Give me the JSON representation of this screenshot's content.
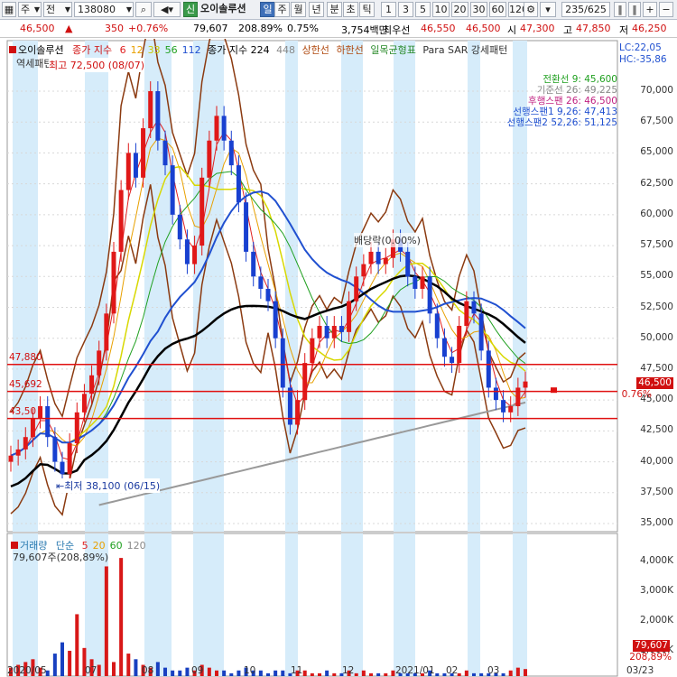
{
  "toolbar": {
    "market": "주",
    "period_mode": "전",
    "code": "138080",
    "stock_name": "오이솔루션",
    "stock_badge": "신",
    "periods": [
      "일",
      "주",
      "월",
      "년",
      "분",
      "초",
      "틱"
    ],
    "active_period": "일",
    "minutes": [
      "1",
      "3",
      "5",
      "10",
      "20",
      "30",
      "60",
      "120"
    ],
    "page": "235/625"
  },
  "quote": {
    "price": "46,500",
    "change": "350",
    "change_pct": "+0.76%",
    "volume": "79,607",
    "volume_ratio": "208.89%",
    "turnover": "0.75%",
    "trade_value": "3,754백만",
    "best_label": "최우선",
    "ask": "46,550",
    "bid": "46,500",
    "open_label": "시",
    "open": "47,300",
    "high_label": "고",
    "high": "47,850",
    "low_label": "저",
    "low": "46,250"
  },
  "legend_top": {
    "name": "오이솔루션",
    "ma_label": "종가 지수",
    "ma_periods": [
      {
        "v": "6",
        "color": "#e02020"
      },
      {
        "v": "12",
        "color": "#e8a000"
      },
      {
        "v": "33",
        "color": "#c8c800"
      },
      {
        "v": "56",
        "color": "#20a020"
      },
      {
        "v": "112",
        "color": "#2050d0"
      }
    ],
    "ma2_label": "종가 지수 224",
    "ma3": "448",
    "limit_up": "상한선",
    "limit_down": "하한선",
    "ichimoku": "일목균형표",
    "parasar": "Para SAR 강세패턴",
    "overlay_text": "역세패턴",
    "lc": "LC:22,05",
    "hc": "HC:-35,86"
  },
  "ichimoku_legend": [
    {
      "text": "전환선 9: 45,600",
      "color": "#20a020"
    },
    {
      "text": "기준선 26: 49,225",
      "color": "#888888"
    },
    {
      "text": "후행스팬 26: 46,500",
      "color": "#c02080"
    },
    {
      "text": "선행스팬1 9,26: 47,413",
      "color": "#2050d0"
    },
    {
      "text": "선행스팬2 52,26: 51,125",
      "color": "#2050d0"
    }
  ],
  "annotations": {
    "high": "최고 72,500 (08/07)",
    "low": "최저 38,100 (06/15)",
    "dividend": "배당락(0.00%)"
  },
  "price_lines": [
    {
      "label": "47,880",
      "value": 47880
    },
    {
      "label": "45,692",
      "value": 45692
    },
    {
      "label": "43,50",
      "value": 43500
    }
  ],
  "current_price": {
    "label": "46,500",
    "pct": "0.76%"
  },
  "price_axis": [
    "70,000",
    "67,500",
    "65,000",
    "62,500",
    "60,000",
    "57,500",
    "55,000",
    "52,500",
    "50,000",
    "47,500",
    "45,000",
    "42,500",
    "40,000",
    "37,500",
    "35,000"
  ],
  "volume_legend": {
    "label": "거래량",
    "ma_label": "단순",
    "periods": [
      {
        "v": "5",
        "color": "#e02020"
      },
      {
        "v": "20",
        "color": "#e8a000"
      },
      {
        "v": "60",
        "color": "#20a020"
      },
      {
        "v": "120",
        "color": "#888888"
      }
    ],
    "current": "79,607주(208,89%)"
  },
  "volume_axis": [
    "4,000K",
    "3,000K",
    "2,000K",
    "1,000K"
  ],
  "volume_current": {
    "label": "79,607",
    "pct": "208,89%"
  },
  "date_axis": [
    "2020/05",
    "07",
    "08",
    "09",
    "10",
    "11",
    "12",
    "2021/01",
    "02",
    "03",
    "03/23"
  ]
}
